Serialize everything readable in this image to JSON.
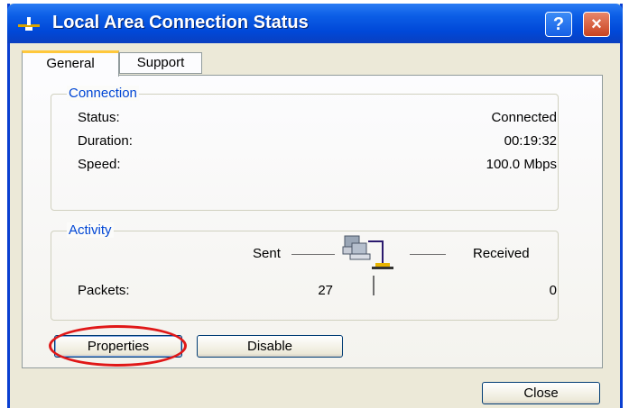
{
  "window": {
    "title": "Local Area Connection Status",
    "help_button": "?",
    "close_icon": "×"
  },
  "tabs": [
    {
      "label": "General",
      "active": true
    },
    {
      "label": "Support",
      "active": false
    }
  ],
  "connection": {
    "group_label": "Connection",
    "rows": [
      {
        "label": "Status:",
        "value": "Connected"
      },
      {
        "label": "Duration:",
        "value": "00:19:32"
      },
      {
        "label": "Speed:",
        "value": "100.0 Mbps"
      }
    ]
  },
  "activity": {
    "group_label": "Activity",
    "sent_label": "Sent",
    "received_label": "Received",
    "packets_label": "Packets:",
    "packets_sent": "27",
    "packets_received": "0",
    "icon": "network-computers-icon"
  },
  "buttons": {
    "properties": "Properties",
    "disable": "Disable",
    "close": "Close"
  },
  "colors": {
    "title_bar": "#0a52e0",
    "group_title": "#0046d5",
    "highlight": "#e01818",
    "active_tab_accent": "#ffc83c"
  }
}
